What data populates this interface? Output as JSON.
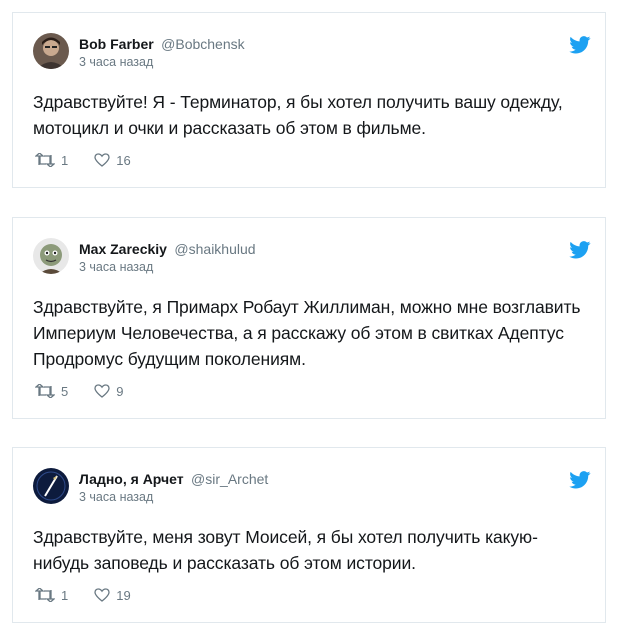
{
  "colors": {
    "twitter_blue": "#1da1f2",
    "muted": "#697882",
    "border": "#e1e8ed",
    "text": "#14171a"
  },
  "tweets": [
    {
      "name": "Bob Farber",
      "handle": "@Bobchensk",
      "time": "3 часа назад",
      "text": "Здравствуйте! Я - Терминатор, я бы хотел получить вашу одежду, мотоцикл и очки и рассказать об этом в фильме.",
      "retweets": "1",
      "likes": "16",
      "avatar_icon": "avatar-photo",
      "retweet_icon": "retweet-icon",
      "like_icon": "heart-icon"
    },
    {
      "name": "Max Zareckiy",
      "handle": "@shaikhulud",
      "time": "3 часа назад",
      "text": "Здравствуйте, я Примарх Робаут Жиллиман, можно мне возглавить Империум Человечества, а я расскажу об этом в свитках Адептус Продромус будущим поколениям.",
      "retweets": "5",
      "likes": "9",
      "avatar_icon": "avatar-cartoon",
      "retweet_icon": "retweet-icon",
      "like_icon": "heart-icon"
    },
    {
      "name": "Ладно, я Арчет",
      "handle": "@sir_Archet",
      "time": "3 часа назад",
      "text": "Здравствуйте, меня зовут Моисей, я бы хотел получить какую-нибудь заповедь и рассказать об этом истории.",
      "retweets": "1",
      "likes": "19",
      "avatar_icon": "avatar-logo",
      "retweet_icon": "retweet-icon",
      "like_icon": "heart-icon"
    }
  ]
}
